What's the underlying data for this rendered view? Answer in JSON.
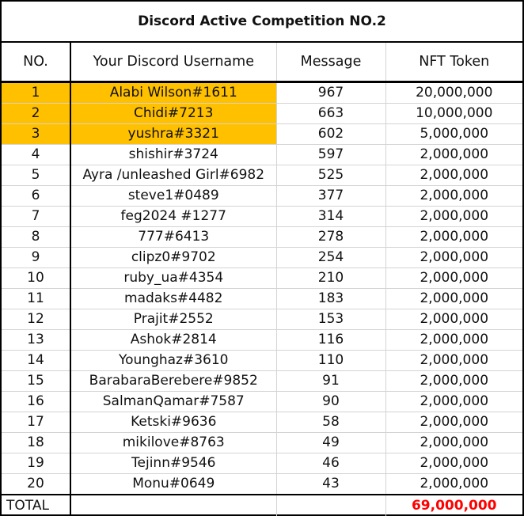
{
  "title": "Discord Active Competition NO.2",
  "columns": [
    "NO.",
    "Your Discord Username",
    "Message",
    "NFT Token"
  ],
  "rows": [
    {
      "no": "1",
      "username": "Alabi Wilson#1611",
      "message": "967",
      "token": "20,000,000",
      "highlight": true
    },
    {
      "no": "2",
      "username": "Chidi#7213",
      "message": "663",
      "token": "10,000,000",
      "highlight": true
    },
    {
      "no": "3",
      "username": "yushra#3321",
      "message": "602",
      "token": "5,000,000",
      "highlight": true
    },
    {
      "no": "4",
      "username": "shishir#3724",
      "message": "597",
      "token": "2,000,000",
      "highlight": false
    },
    {
      "no": "5",
      "username": "Ayra /unleashed Girl#6982",
      "message": "525",
      "token": "2,000,000",
      "highlight": false
    },
    {
      "no": "6",
      "username": "steve1#0489",
      "message": "377",
      "token": "2,000,000",
      "highlight": false
    },
    {
      "no": "7",
      "username": "feg2024 #1277",
      "message": "314",
      "token": "2,000,000",
      "highlight": false
    },
    {
      "no": "8",
      "username": "777#6413",
      "message": "278",
      "token": "2,000,000",
      "highlight": false
    },
    {
      "no": "9",
      "username": "clipz0#9702",
      "message": "254",
      "token": "2,000,000",
      "highlight": false
    },
    {
      "no": "10",
      "username": "ruby_ua#4354",
      "message": "210",
      "token": "2,000,000",
      "highlight": false
    },
    {
      "no": "11",
      "username": "madaks#4482",
      "message": "183",
      "token": "2,000,000",
      "highlight": false
    },
    {
      "no": "12",
      "username": "Prajit#2552",
      "message": "153",
      "token": "2,000,000",
      "highlight": false
    },
    {
      "no": "13",
      "username": "Ashok#2814",
      "message": "116",
      "token": "2,000,000",
      "highlight": false
    },
    {
      "no": "14",
      "username": "Younghaz#3610",
      "message": "110",
      "token": "2,000,000",
      "highlight": false
    },
    {
      "no": "15",
      "username": "BarabaraBerebere#9852",
      "message": "91",
      "token": "2,000,000",
      "highlight": false
    },
    {
      "no": "16",
      "username": "SalmanQamar#7587",
      "message": "90",
      "token": "2,000,000",
      "highlight": false
    },
    {
      "no": "17",
      "username": "Ketski#9636",
      "message": "58",
      "token": "2,000,000",
      "highlight": false
    },
    {
      "no": "18",
      "username": "mikilove#8763",
      "message": "49",
      "token": "2,000,000",
      "highlight": false
    },
    {
      "no": "19",
      "username": "Tejinn#9546",
      "message": "46",
      "token": "2,000,000",
      "highlight": false
    },
    {
      "no": "20",
      "username": "Monu#0649",
      "message": "43",
      "token": "2,000,000",
      "highlight": false
    }
  ],
  "total": {
    "label": "TOTAL",
    "username": "",
    "message": "",
    "token": "69,000,000"
  },
  "colors": {
    "highlight": "#ffc000",
    "total_text": "#ff0000"
  }
}
